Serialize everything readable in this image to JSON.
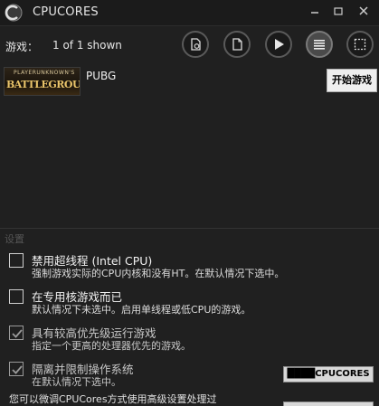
{
  "window": {
    "title": "CPUCORES"
  },
  "toolbar": {
    "games_label": "游戏：",
    "games_count": "1 of 1 shown",
    "buttons": [
      {
        "icon": "add-game-icon"
      },
      {
        "icon": "document-icon"
      },
      {
        "icon": "play-icon"
      },
      {
        "icon": "list-view-icon",
        "active": true
      },
      {
        "icon": "select-frame-icon"
      }
    ],
    "tooltip": "开始游戏"
  },
  "games": [
    {
      "name": "PUBG",
      "thumb_small": "PLAYERUNKNOWN'S",
      "thumb_big": "BATTLEGROUNDS"
    }
  ],
  "settings": {
    "section_title": "设置",
    "items": [
      {
        "title": "禁用超线程 (Intel CPU)",
        "desc": "强制游戏实际的CPU内核和没有HT。在默认情况下选中。",
        "checked": false
      },
      {
        "title": "在专用核游戏而已",
        "desc": "默认情况下未选中。启用单线程或低CPU的游戏。",
        "checked": false
      },
      {
        "title": "具有较高优先级运行游戏",
        "desc": "指定一个更高的处理器优先的游戏。",
        "checked": true
      },
      {
        "title": "隔离并限制操作系统",
        "desc": "在默认情况下选中。",
        "checked": true
      }
    ],
    "cpucores_button": "████CPUCORES",
    "footer": "您可以微调CPUCores方式使用高级设置处理过"
  },
  "colors": {
    "background": "#202020",
    "titlebar": "#1b1b1b",
    "button_border": "#5a5a5a"
  }
}
